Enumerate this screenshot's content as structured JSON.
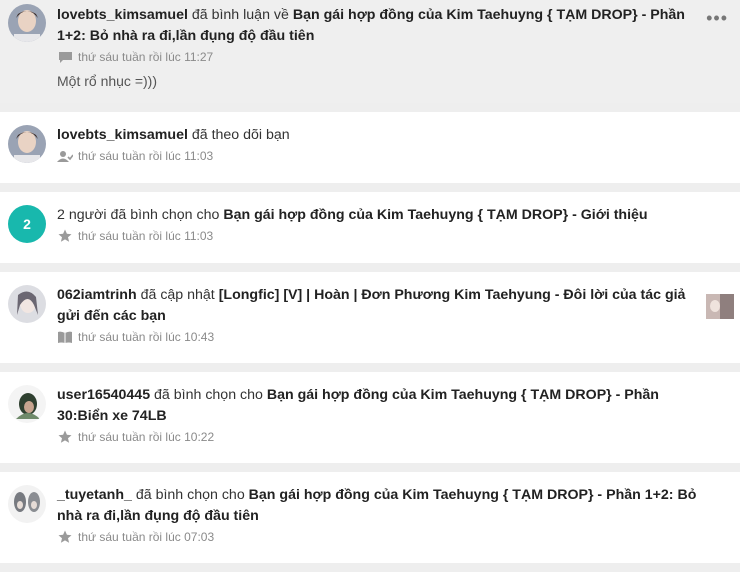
{
  "notifications": [
    {
      "user": "lovebts_kimsamuel",
      "action": "đã bình luận về",
      "target": "Bạn gái hợp đồng của Kim Taehuyng { TẠM DROP} - Phần 1+2: Bỏ nhà ra đi,lần đụng độ đầu tiên",
      "time": "thứ sáu tuần rồi lúc 11:27",
      "icon": "comment-icon",
      "comment": "Một rổ nhục =)))"
    },
    {
      "user": "lovebts_kimsamuel",
      "action": "đã theo dõi bạn",
      "time": "thứ sáu tuần rồi lúc 11:03",
      "icon": "follow-icon"
    },
    {
      "badge": "2",
      "action": "2 người đã bình chọn cho",
      "target": "Bạn gái hợp đồng của Kim Taehuyng { TẠM DROP} - Giới thiệu",
      "time": "thứ sáu tuần rồi lúc 11:03",
      "icon": "star-icon"
    },
    {
      "user": "062iamtrinh",
      "action": "đã cập nhật",
      "target": "[Longfic] [V] | Hoàn | Đơn Phương Kim Taehyung - Đôi lời của tác giả gửi đến các bạn",
      "time": "thứ sáu tuần rồi lúc 10:43",
      "icon": "book-icon"
    },
    {
      "user": "user16540445",
      "action": "đã bình chọn cho",
      "target": "Bạn gái hợp đồng của Kim Taehuyng { TẠM DROP} - Phần 30:Biển xe 74LB",
      "time": "thứ sáu tuần rồi lúc 10:22",
      "icon": "star-icon"
    },
    {
      "user": "_tuyetanh_",
      "action": "đã bình chọn cho",
      "target": "Bạn gái hợp đồng của Kim Taehuyng { TẠM DROP} - Phần 1+2: Bỏ nhà ra đi,lần đụng độ đầu tiên",
      "time": "thứ sáu tuần rồi lúc 07:03",
      "icon": "star-icon"
    }
  ],
  "more_menu": "•••",
  "colors": {
    "badge": "#18b8ad",
    "highlight_bg": "#efefef",
    "meta_text": "#8a8a8a"
  }
}
